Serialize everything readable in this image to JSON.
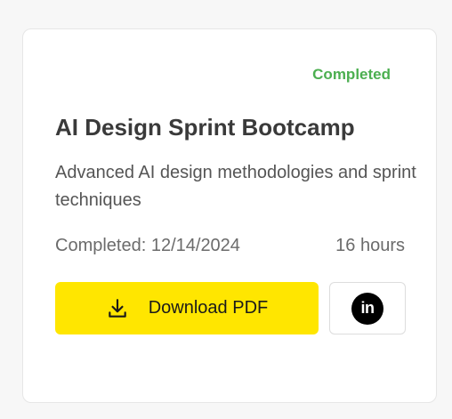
{
  "card": {
    "status": "Completed",
    "title": "AI Design Sprint Bootcamp",
    "description": "Advanced AI design methodologies and sprint techniques",
    "completed_date": "Completed: 12/14/2024",
    "duration": "16 hours"
  },
  "actions": {
    "download_label": "Download PDF",
    "download_icon": "download-icon",
    "linkedin_icon": "linkedin-icon",
    "linkedin_glyph": "in"
  },
  "colors": {
    "status": "#4caf50",
    "primary_button": "#ffe600",
    "linkedin": "#000000"
  }
}
